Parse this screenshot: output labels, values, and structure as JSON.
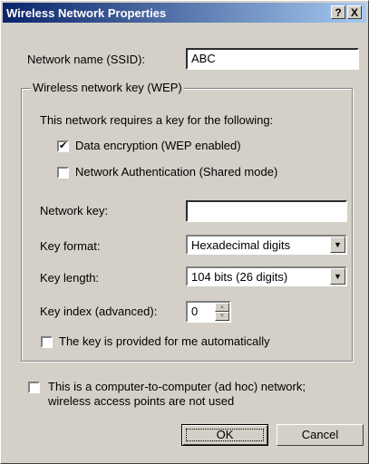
{
  "window": {
    "title": "Wireless Network Properties",
    "help_btn": "?",
    "close_btn": "X"
  },
  "ssid": {
    "label": "Network name (SSID):",
    "value": "ABC"
  },
  "wep": {
    "group_label": "Wireless network key (WEP)",
    "requires_text": "This network requires a key for the following:",
    "data_encryption": {
      "label": "Data encryption (WEP enabled)",
      "checked": true
    },
    "network_auth": {
      "label": "Network Authentication (Shared mode)",
      "checked": false
    },
    "network_key": {
      "label": "Network key:",
      "value": ""
    },
    "key_format": {
      "label": "Key format:",
      "value": "Hexadecimal digits"
    },
    "key_length": {
      "label": "Key length:",
      "value": "104 bits (26 digits)"
    },
    "key_index": {
      "label": "Key index (advanced):",
      "value": "0"
    },
    "auto_key": {
      "label": "The key is provided for me automatically",
      "checked": false
    }
  },
  "adhoc": {
    "label_line1": "This is a computer-to-computer (ad hoc) network;",
    "label_line2": "wireless access points are not used",
    "checked": false
  },
  "buttons": {
    "ok": "OK",
    "cancel": "Cancel"
  },
  "icons": {
    "check": "✔",
    "dropdown": "▼",
    "spin_up": "▲",
    "spin_down": "▼"
  }
}
